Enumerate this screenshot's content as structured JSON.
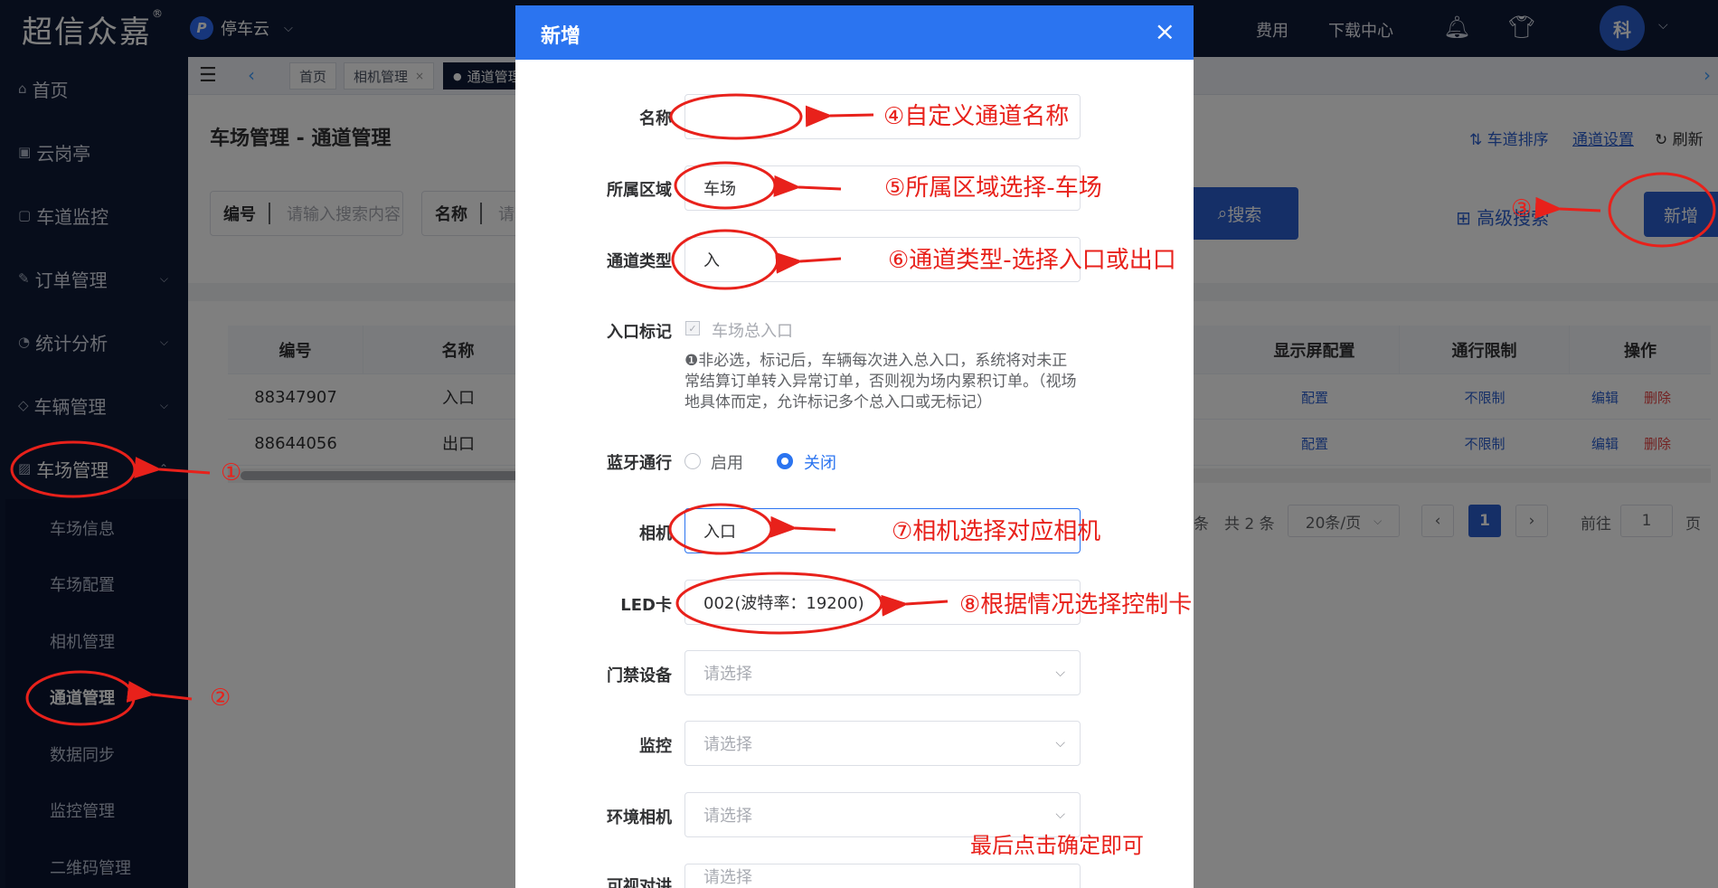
{
  "header": {
    "logo": "超信众嘉",
    "logo_mark": "®",
    "app_badge": "P",
    "app_name": "停车云",
    "links": [
      "费用",
      "下载中心"
    ],
    "avatar": "科"
  },
  "sidebar": {
    "items": [
      {
        "label": "首页",
        "icon": "home-icon"
      },
      {
        "label": "云岗亭",
        "icon": "booth-icon"
      },
      {
        "label": "车道监控",
        "icon": "monitor-icon"
      },
      {
        "label": "订单管理",
        "icon": "order-icon"
      },
      {
        "label": "统计分析",
        "icon": "chart-icon"
      },
      {
        "label": "车辆管理",
        "icon": "car-icon"
      },
      {
        "label": "车场管理",
        "icon": "parking-icon"
      }
    ],
    "sub_items": [
      "车场信息",
      "车场配置",
      "相机管理",
      "通道管理",
      "数据同步",
      "监控管理",
      "二维码管理"
    ]
  },
  "tabs": {
    "items": [
      "首页",
      "相机管理",
      "通道管理"
    ]
  },
  "page": {
    "title": "车场管理 - 通道管理",
    "sort_link": "车道排序",
    "channel_settings": "通道设置",
    "refresh": "刷新",
    "search": [
      {
        "label": "编号",
        "placeholder": "请输入搜索内容"
      },
      {
        "label": "名称",
        "placeholder": "请输入搜索内容"
      }
    ],
    "search_btn": "搜索",
    "advanced_search": "高级搜索",
    "add_btn": "新增"
  },
  "table": {
    "headers": {
      "id": "编号",
      "name": "名称",
      "display": "显示屏配置",
      "limit": "通行限制",
      "ops": "操作"
    },
    "rows": [
      {
        "id": "88347907",
        "name": "入口",
        "display": "配置",
        "limit": "不限制",
        "edit": "编辑",
        "delete": "删除"
      },
      {
        "id": "88644056",
        "name": "出口",
        "display": "配置",
        "limit": "不限制",
        "edit": "编辑",
        "delete": "删除"
      }
    ]
  },
  "pagination": {
    "partial": "条",
    "total": "共 2 条",
    "page_size": "20条/页",
    "current": "1",
    "goto": "前往",
    "goto_value": "1",
    "page_unit": "页"
  },
  "modal": {
    "title": "新增",
    "fields": {
      "name": {
        "label": "名称",
        "value": ""
      },
      "area": {
        "label": "所属区域",
        "value": "车场"
      },
      "type": {
        "label": "通道类型",
        "value": "入"
      },
      "entry_mark": {
        "label": "入口标记",
        "checkbox": "车场总入口",
        "hint": "非必选，标记后，车辆每次进入总入口，系统将对未正常结算订单转入异常订单，否则视为场内累积订单。（视场地具体而定，允许标记多个总入口或无标记）"
      },
      "bluetooth": {
        "label": "蓝牙通行",
        "on": "启用",
        "off": "关闭",
        "selected": "关闭"
      },
      "camera": {
        "label": "相机",
        "value": "入口"
      },
      "led": {
        "label": "LED卡",
        "value": "002(波特率：19200)"
      },
      "gate": {
        "label": "门禁设备",
        "placeholder": "请选择"
      },
      "monitor": {
        "label": "监控",
        "placeholder": "请选择"
      },
      "env_camera": {
        "label": "环境相机",
        "placeholder": "请选择"
      },
      "intercom": {
        "label": "可视对讲",
        "placeholder": "请选择"
      }
    }
  },
  "annotations": {
    "n1": "①",
    "n2": "②",
    "n3": "③",
    "a4": "④自定义通道名称",
    "a5": "⑤所属区域选择-车场",
    "a6": "⑥通道类型-选择入口或出口",
    "a7": "⑦相机选择对应相机",
    "a8": "⑧根据情况选择控制卡",
    "final": "最后点击确定即可",
    "color": "#e8211b"
  },
  "colors": {
    "sidebar": "#0e1a36",
    "primary": "#2b5fce",
    "modal_header": "#2b74f0",
    "danger": "#e64242"
  }
}
